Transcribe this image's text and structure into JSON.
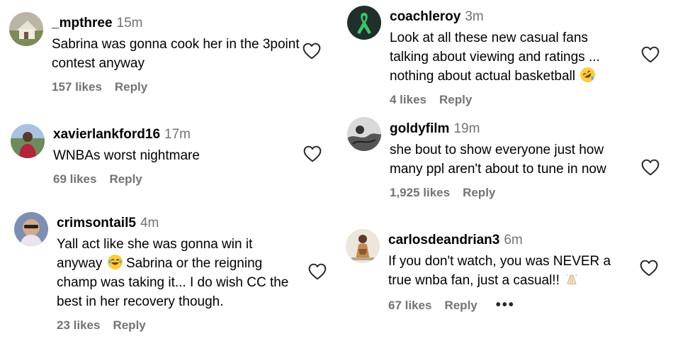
{
  "comments": [
    {
      "username": "_mpthree",
      "time": "15m",
      "text": "Sabrina was gonna cook her in the 3point contest anyway",
      "likes": "157 likes",
      "reply": "Reply",
      "avatar": "avatar-photo-house"
    },
    {
      "username": "xavierlankford16",
      "time": "17m",
      "text": "WNBAs worst nightmare",
      "likes": "69 likes",
      "reply": "Reply",
      "avatar": "avatar-photo-person-red"
    },
    {
      "username": "crimsontail5",
      "time": "4m",
      "text_before_emoji": "Yall act like she was gonna win it anyway ",
      "emoji": "face-with-tears-of-joy",
      "text_after_emoji": " Sabrina or the reigning champ was taking it... I do wish CC the best in her recovery though.",
      "likes": "23 likes",
      "reply": "Reply",
      "avatar": "avatar-photo-selfie"
    },
    {
      "username": "coachleroy",
      "time": "3m",
      "text": "Look at all these new casual fans talking about viewing and ratings ... nothing about actual basketball",
      "emoji": "rolling-on-floor-laughing",
      "likes": "4 likes",
      "reply": "Reply",
      "avatar": "avatar-green-ribbon"
    },
    {
      "username": "goldyfilm",
      "time": "19m",
      "text": "she bout to show everyone just how many ppl aren't about to tune in now",
      "likes": "1,925 likes",
      "reply": "Reply",
      "avatar": "avatar-photo-bw"
    },
    {
      "username": "carlosdeandrian3",
      "time": "6m",
      "text": "If you don't watch, you was NEVER a true wnba fan, just a casual!!",
      "emoji": "folded-hands",
      "likes": "67 likes",
      "reply": "Reply",
      "more": "•••",
      "avatar": "avatar-photo-figure"
    }
  ],
  "icons": {
    "like": "heart-outline-icon",
    "more": "more-options-icon"
  },
  "colors": {
    "text": "#000000",
    "secondary": "#737373",
    "heart_stroke": "#262626"
  }
}
